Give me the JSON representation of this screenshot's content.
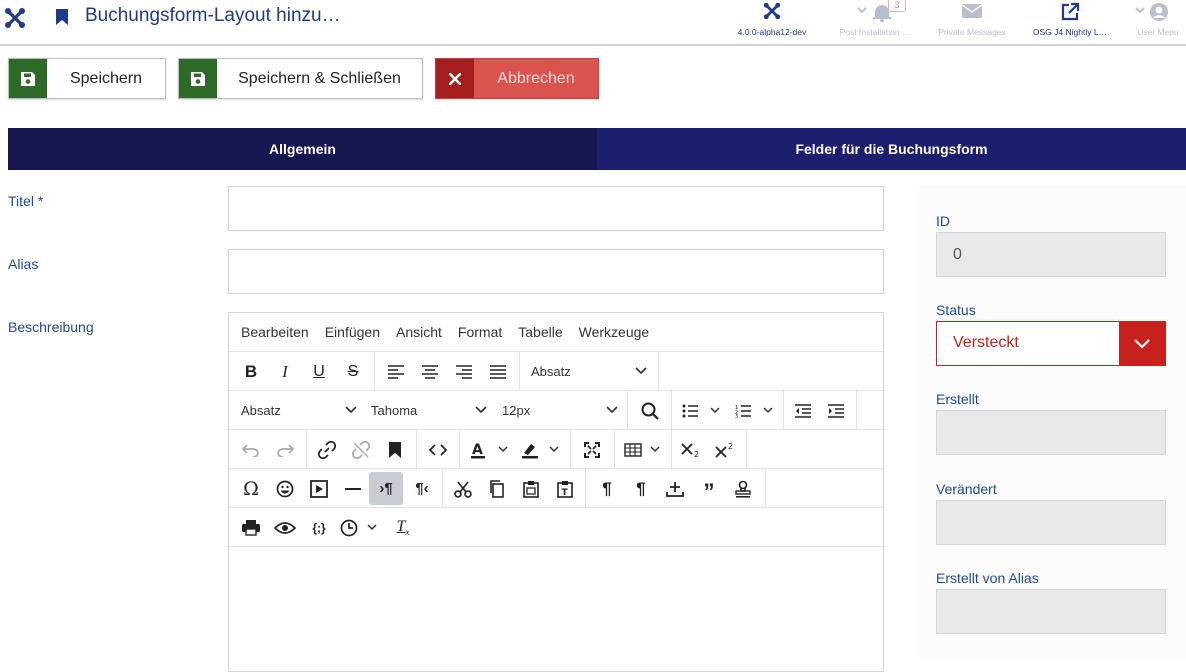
{
  "header": {
    "title": "Buchungsform-Layout hinzu…",
    "items": [
      {
        "label": "4.0.0-alpha12-dev"
      },
      {
        "label": "Post Installation …",
        "badge": "3"
      },
      {
        "label": "Private Messages"
      },
      {
        "label": "OSG J4 Nightly L…"
      },
      {
        "label": "User Menu"
      }
    ]
  },
  "toolbar": {
    "save_label": "Speichern",
    "save_close_label": "Speichern & Schließen",
    "cancel_label": "Abbrechen"
  },
  "tabs": [
    {
      "label": "Allgemein",
      "active": true
    },
    {
      "label": "Felder für die Buchungsform",
      "active": false
    }
  ],
  "form": {
    "title_label": "Titel *",
    "alias_label": "Alias",
    "description_label": "Beschreibung",
    "title_value": "",
    "alias_value": ""
  },
  "editor": {
    "menu": [
      "Bearbeiten",
      "Einfügen",
      "Ansicht",
      "Format",
      "Tabelle",
      "Werkzeuge"
    ],
    "block_format_1": "Absatz",
    "block_format_2": "Absatz",
    "font_family": "Tahoma",
    "font_size": "12px"
  },
  "sidebar": {
    "id_label": "ID",
    "id_value": "0",
    "status_label": "Status",
    "status_value": "Versteckt",
    "created_label": "Erstellt",
    "modified_label": "Verändert",
    "created_by_alias_label": "Erstellt von Alias"
  },
  "colors": {
    "accent": "#1f3a8a",
    "tabs_bg": "#1e1e6e",
    "save_green": "#2d6a27",
    "cancel_red": "#d9534f",
    "status_red": "#c8201c"
  }
}
